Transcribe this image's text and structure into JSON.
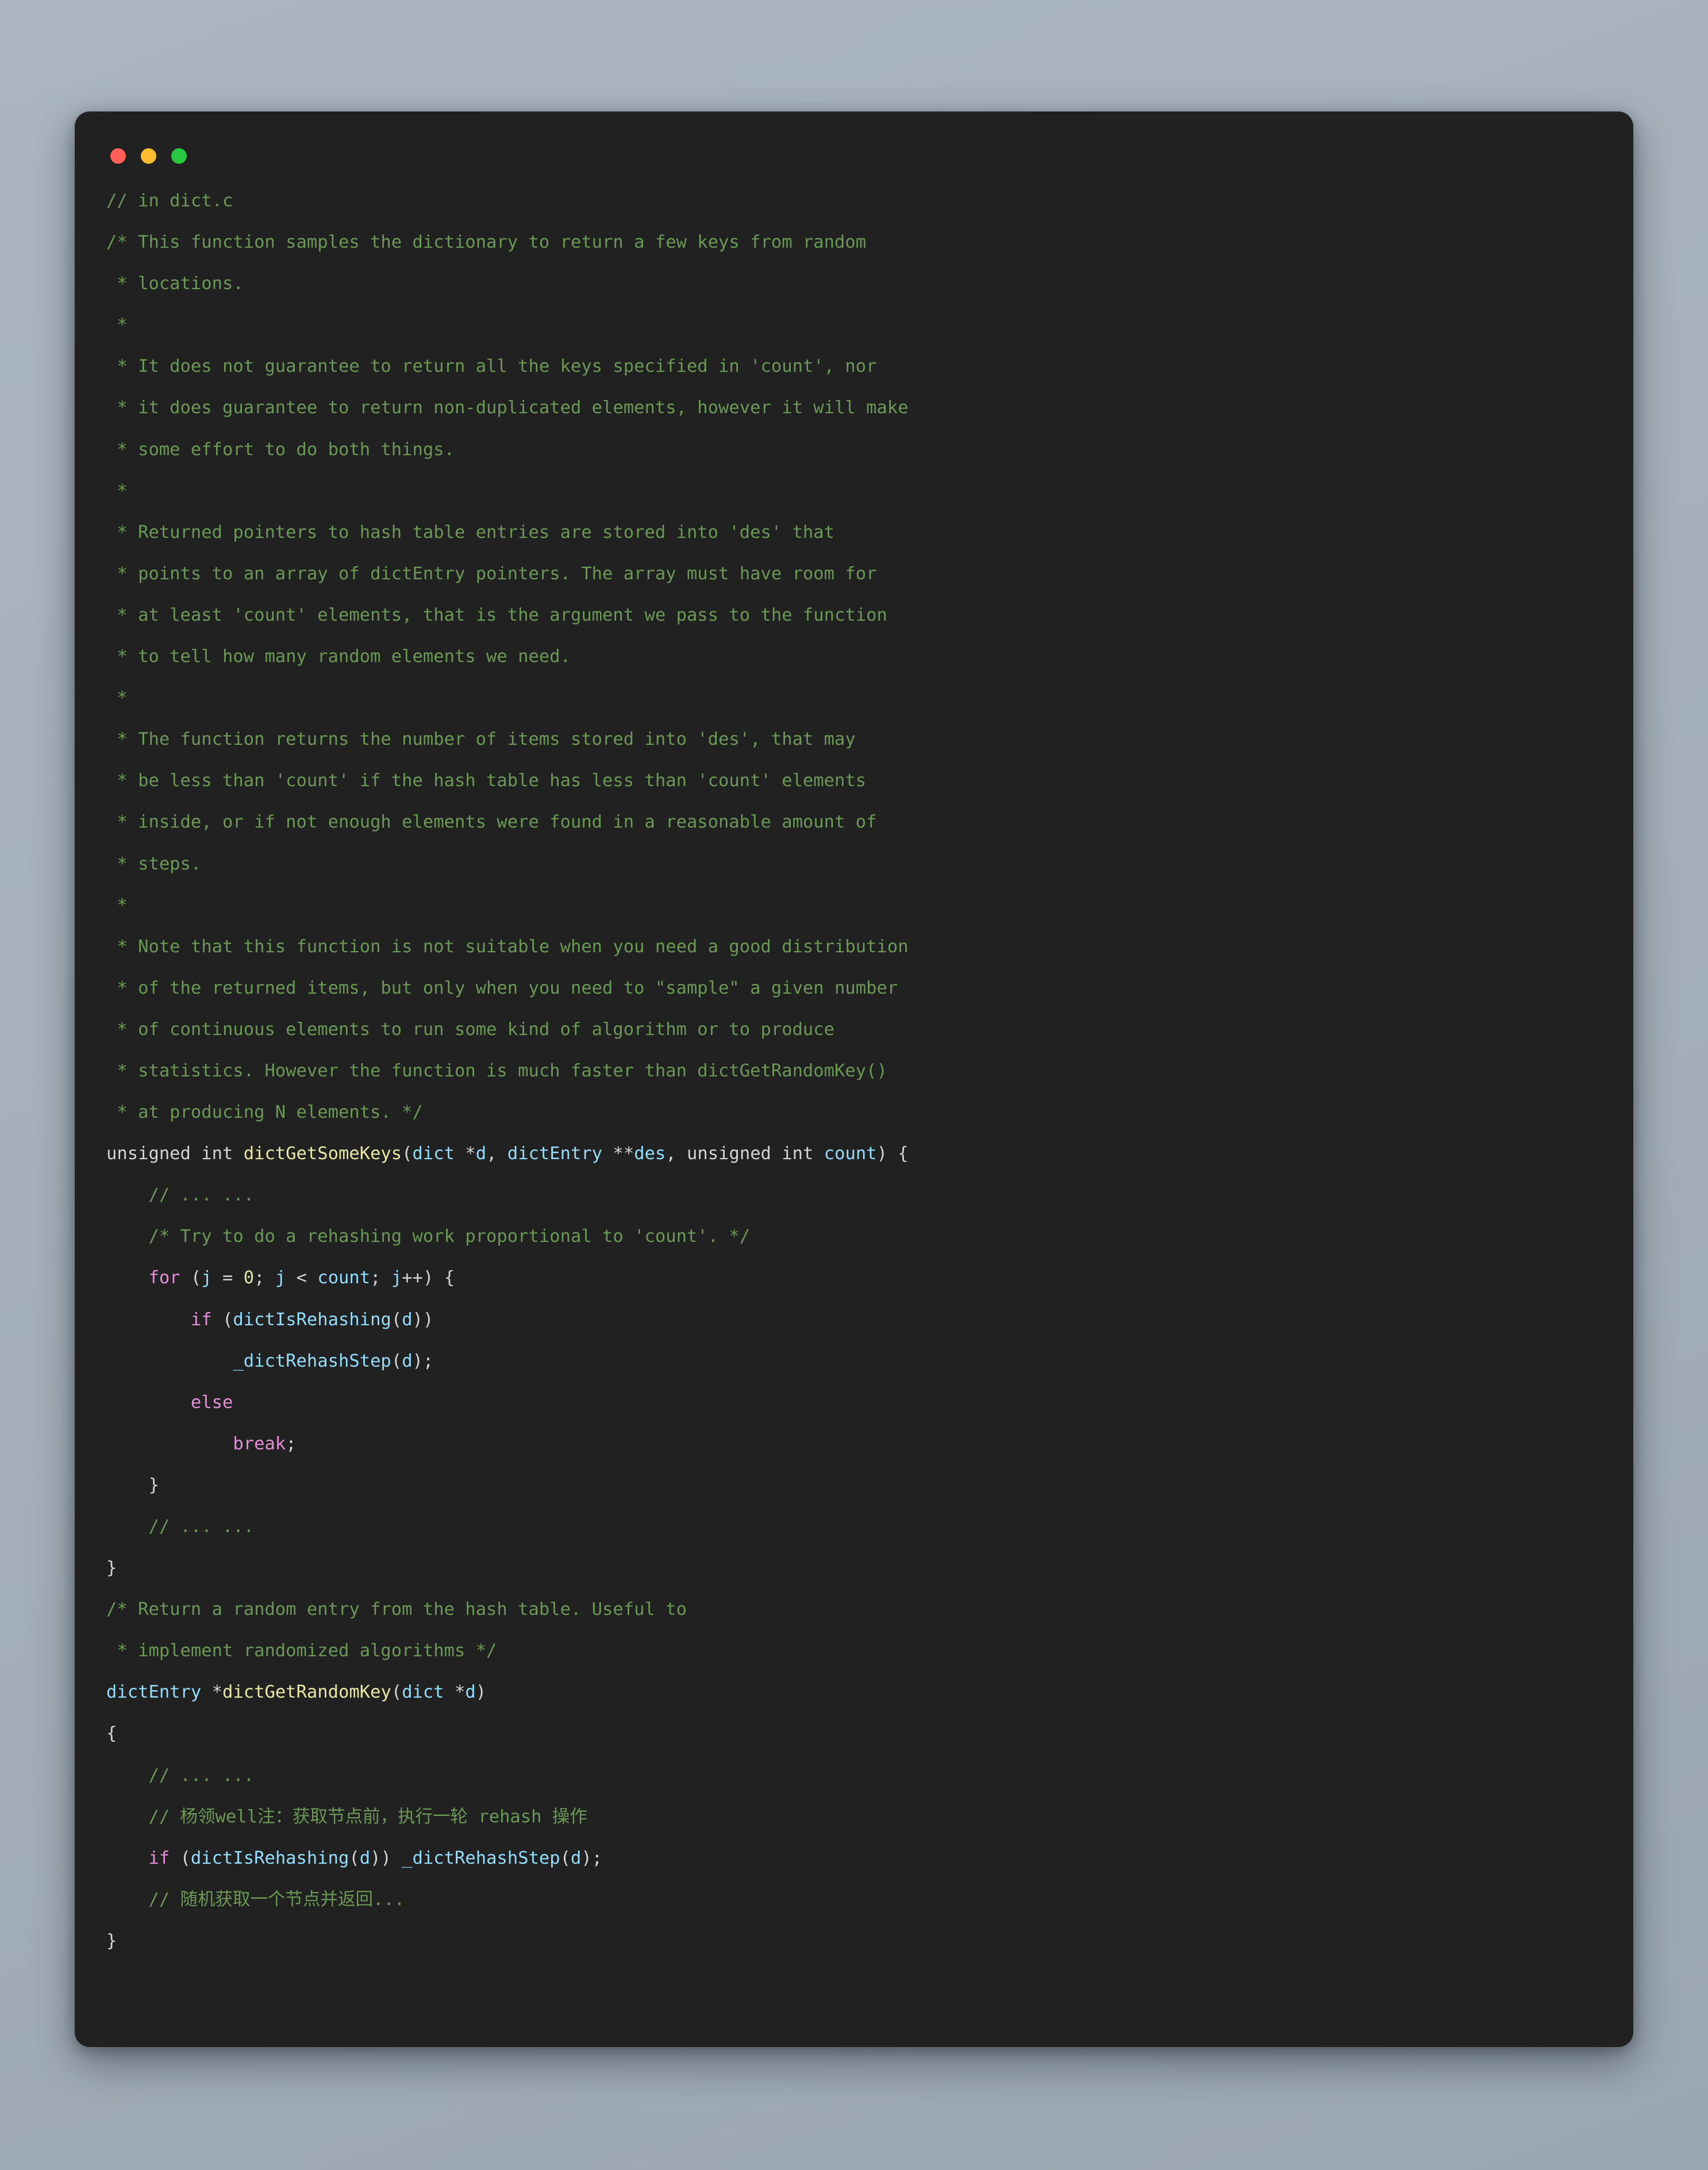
{
  "window": {
    "name": "code-snippet-window",
    "background_color": "#212121",
    "page_background_color": "#a8b3bd",
    "traffic_lights": [
      {
        "name": "close",
        "color": "#ff5f57"
      },
      {
        "name": "minimize",
        "color": "#febc2e"
      },
      {
        "name": "maximize",
        "color": "#28c840"
      }
    ]
  },
  "theme": {
    "comment": "#6a9955",
    "keyword": "#e48fd8",
    "function": "#e8e8a6",
    "identifier": "#93ddfd",
    "plain": "#d4d4d4",
    "number": "#d7e8a8"
  },
  "code": {
    "language": "c",
    "lines": [
      {
        "tokens": [
          {
            "t": "// in dict.c",
            "c": "c"
          }
        ]
      },
      {
        "tokens": [
          {
            "t": "/* This function samples the dictionary to return a few keys from random",
            "c": "c"
          }
        ]
      },
      {
        "tokens": [
          {
            "t": " * locations.",
            "c": "c"
          }
        ]
      },
      {
        "tokens": [
          {
            "t": " *",
            "c": "c"
          }
        ]
      },
      {
        "tokens": [
          {
            "t": " * It does not guarantee to return all the keys specified in 'count', nor",
            "c": "c"
          }
        ]
      },
      {
        "tokens": [
          {
            "t": " * it does guarantee to return non-duplicated elements, however it will make",
            "c": "c"
          }
        ]
      },
      {
        "tokens": [
          {
            "t": " * some effort to do both things.",
            "c": "c"
          }
        ]
      },
      {
        "tokens": [
          {
            "t": " *",
            "c": "c"
          }
        ]
      },
      {
        "tokens": [
          {
            "t": " * Returned pointers to hash table entries are stored into 'des' that",
            "c": "c"
          }
        ]
      },
      {
        "tokens": [
          {
            "t": " * points to an array of dictEntry pointers. The array must have room for",
            "c": "c"
          }
        ]
      },
      {
        "tokens": [
          {
            "t": " * at least 'count' elements, that is the argument we pass to the function",
            "c": "c"
          }
        ]
      },
      {
        "tokens": [
          {
            "t": " * to tell how many random elements we need.",
            "c": "c"
          }
        ]
      },
      {
        "tokens": [
          {
            "t": " *",
            "c": "c"
          }
        ]
      },
      {
        "tokens": [
          {
            "t": " * The function returns the number of items stored into 'des', that may",
            "c": "c"
          }
        ]
      },
      {
        "tokens": [
          {
            "t": " * be less than 'count' if the hash table has less than 'count' elements",
            "c": "c"
          }
        ]
      },
      {
        "tokens": [
          {
            "t": " * inside, or if not enough elements were found in a reasonable amount of",
            "c": "c"
          }
        ]
      },
      {
        "tokens": [
          {
            "t": " * steps.",
            "c": "c"
          }
        ]
      },
      {
        "tokens": [
          {
            "t": " *",
            "c": "c"
          }
        ]
      },
      {
        "tokens": [
          {
            "t": " * Note that this function is not suitable when you need a good distribution",
            "c": "c"
          }
        ]
      },
      {
        "tokens": [
          {
            "t": " * of the returned items, but only when you need to \"sample\" a given number",
            "c": "c"
          }
        ]
      },
      {
        "tokens": [
          {
            "t": " * of continuous elements to run some kind of algorithm or to produce",
            "c": "c"
          }
        ]
      },
      {
        "tokens": [
          {
            "t": " * statistics. However the function is much faster than dictGetRandomKey()",
            "c": "c"
          }
        ]
      },
      {
        "tokens": [
          {
            "t": " * at producing N elements. */",
            "c": "c"
          }
        ]
      },
      {
        "tokens": [
          {
            "t": "unsigned int ",
            "c": "p"
          },
          {
            "t": "dictGetSomeKeys",
            "c": "f"
          },
          {
            "t": "(",
            "c": "p"
          },
          {
            "t": "dict",
            "c": "i"
          },
          {
            "t": " *",
            "c": "p"
          },
          {
            "t": "d",
            "c": "i"
          },
          {
            "t": ", ",
            "c": "p"
          },
          {
            "t": "dictEntry",
            "c": "i"
          },
          {
            "t": " **",
            "c": "p"
          },
          {
            "t": "des",
            "c": "i"
          },
          {
            "t": ", unsigned int ",
            "c": "p"
          },
          {
            "t": "count",
            "c": "i"
          },
          {
            "t": ") {",
            "c": "p"
          }
        ]
      },
      {
        "tokens": [
          {
            "t": "    // ... ...",
            "c": "c"
          }
        ]
      },
      {
        "tokens": [
          {
            "t": "    /* Try to do a rehashing work proportional to 'count'. */",
            "c": "c"
          }
        ]
      },
      {
        "tokens": [
          {
            "t": "    ",
            "c": "p"
          },
          {
            "t": "for",
            "c": "k"
          },
          {
            "t": " (",
            "c": "p"
          },
          {
            "t": "j",
            "c": "i"
          },
          {
            "t": " = ",
            "c": "p"
          },
          {
            "t": "0",
            "c": "n"
          },
          {
            "t": "; ",
            "c": "p"
          },
          {
            "t": "j",
            "c": "i"
          },
          {
            "t": " < ",
            "c": "p"
          },
          {
            "t": "count",
            "c": "i"
          },
          {
            "t": "; ",
            "c": "p"
          },
          {
            "t": "j",
            "c": "i"
          },
          {
            "t": "++) {",
            "c": "p"
          }
        ]
      },
      {
        "tokens": [
          {
            "t": "        ",
            "c": "p"
          },
          {
            "t": "if",
            "c": "k"
          },
          {
            "t": " (",
            "c": "p"
          },
          {
            "t": "dictIsRehashing",
            "c": "i"
          },
          {
            "t": "(",
            "c": "p"
          },
          {
            "t": "d",
            "c": "i"
          },
          {
            "t": "))",
            "c": "p"
          }
        ]
      },
      {
        "tokens": [
          {
            "t": "            ",
            "c": "p"
          },
          {
            "t": "_dictRehashStep",
            "c": "i"
          },
          {
            "t": "(",
            "c": "p"
          },
          {
            "t": "d",
            "c": "i"
          },
          {
            "t": ");",
            "c": "p"
          }
        ]
      },
      {
        "tokens": [
          {
            "t": "        ",
            "c": "p"
          },
          {
            "t": "else",
            "c": "k"
          }
        ]
      },
      {
        "tokens": [
          {
            "t": "            ",
            "c": "p"
          },
          {
            "t": "break",
            "c": "k"
          },
          {
            "t": ";",
            "c": "p"
          }
        ]
      },
      {
        "tokens": [
          {
            "t": "    }",
            "c": "p"
          }
        ]
      },
      {
        "tokens": [
          {
            "t": "    // ... ...",
            "c": "c"
          }
        ]
      },
      {
        "tokens": [
          {
            "t": "}",
            "c": "p"
          }
        ]
      },
      {
        "tokens": [
          {
            "t": "/* Return a random entry from the hash table. Useful to",
            "c": "c"
          }
        ]
      },
      {
        "tokens": [
          {
            "t": " * implement randomized algorithms */",
            "c": "c"
          }
        ]
      },
      {
        "tokens": [
          {
            "t": "dictEntry",
            "c": "i"
          },
          {
            "t": " *",
            "c": "p"
          },
          {
            "t": "dictGetRandomKey",
            "c": "f"
          },
          {
            "t": "(",
            "c": "p"
          },
          {
            "t": "dict",
            "c": "i"
          },
          {
            "t": " *",
            "c": "p"
          },
          {
            "t": "d",
            "c": "i"
          },
          {
            "t": ")",
            "c": "p"
          }
        ]
      },
      {
        "tokens": [
          {
            "t": "{",
            "c": "p"
          }
        ]
      },
      {
        "tokens": [
          {
            "t": "    // ... ...",
            "c": "c"
          }
        ]
      },
      {
        "tokens": [
          {
            "t": "    // 杨领well注：获取节点前，执行一轮 rehash 操作",
            "c": "cz"
          }
        ]
      },
      {
        "tokens": [
          {
            "t": "    ",
            "c": "p"
          },
          {
            "t": "if",
            "c": "k"
          },
          {
            "t": " (",
            "c": "p"
          },
          {
            "t": "dictIsRehashing",
            "c": "i"
          },
          {
            "t": "(",
            "c": "p"
          },
          {
            "t": "d",
            "c": "i"
          },
          {
            "t": ")) ",
            "c": "p"
          },
          {
            "t": "_dictRehashStep",
            "c": "i"
          },
          {
            "t": "(",
            "c": "p"
          },
          {
            "t": "d",
            "c": "i"
          },
          {
            "t": ");",
            "c": "p"
          }
        ]
      },
      {
        "tokens": [
          {
            "t": "    // 随机获取一个节点并返回...",
            "c": "cz"
          }
        ]
      },
      {
        "tokens": [
          {
            "t": "}",
            "c": "p"
          }
        ]
      }
    ]
  }
}
